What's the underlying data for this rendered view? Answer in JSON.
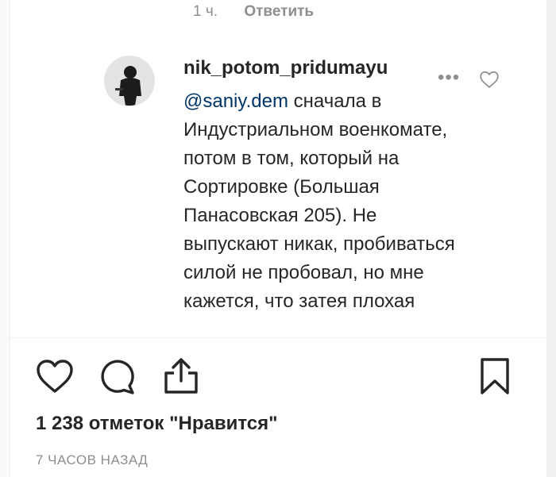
{
  "prev_comment": {
    "time": "1 ч.",
    "reply_label": "Ответить"
  },
  "comment": {
    "username": "nik_potom_pridumayu",
    "mention": "@saniy.dem",
    "text": " сначала в Индустриальном военкомате, потом в том, который на Сортировке (Большая Панасовская 205). Не выпускают никак, пробиваться силой не пробовал, но мне кажется, что затея плохая",
    "more_icon": "more-horizontal-icon",
    "like_icon": "heart-outline-icon"
  },
  "actions": {
    "like_icon": "heart-outline-icon",
    "comment_icon": "speech-bubble-icon",
    "share_icon": "share-upload-icon",
    "save_icon": "bookmark-icon"
  },
  "likes_text": "1 238 отметок \"Нравится\"",
  "time_ago": "7 ЧАСОВ НАЗАД"
}
